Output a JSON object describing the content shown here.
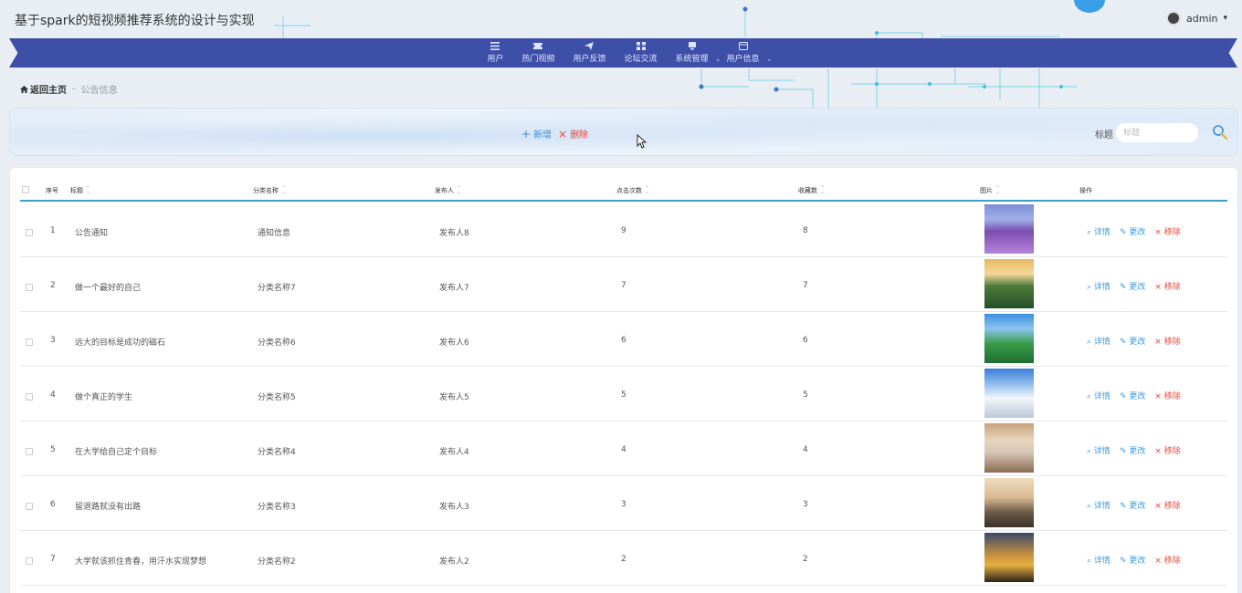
{
  "app": {
    "title": "基于spark的短视频推荐系统的设计与实现"
  },
  "user": {
    "name": "admin",
    "caret": "▾"
  },
  "nav": {
    "items": [
      {
        "label": "用户",
        "icon": "menu-icon",
        "dropdown": false
      },
      {
        "label": "热门视频",
        "icon": "ticket-icon",
        "dropdown": false
      },
      {
        "label": "用户反馈",
        "icon": "paper-plane-icon",
        "dropdown": false
      },
      {
        "label": "论坛交流",
        "icon": "grid-icon",
        "dropdown": false
      },
      {
        "label": "系统管理",
        "icon": "monitor-icon",
        "dropdown": true
      },
      {
        "label": "用户信息",
        "icon": "window-icon",
        "dropdown": true
      }
    ],
    "caret": "⌄"
  },
  "breadcrumb": {
    "home": "返回主页",
    "separator": "-",
    "current": "公告信息"
  },
  "toolbar": {
    "add_icon": "+",
    "add_label": "新增",
    "delete_icon": "×",
    "delete_label": "删除",
    "search_label": "标题",
    "search_placeholder": "标题",
    "search_value": ""
  },
  "table": {
    "headers": {
      "index": "序号",
      "title": "标题",
      "category": "分类名称",
      "publisher": "发布人",
      "clicks": "点击次数",
      "favorites": "收藏数",
      "image": "图片",
      "actions": "操作"
    },
    "sort_glyph_up": "⌃",
    "sort_glyph_down": "⌄",
    "actions": {
      "detail_icon": "⌕",
      "detail": "详情",
      "edit_icon": "✎",
      "edit": "更改",
      "remove_icon": "×",
      "remove": "移除"
    },
    "rows": [
      {
        "index": "1",
        "title": "公告通知",
        "category": "通知信息",
        "publisher": "发布人8",
        "clicks": "9",
        "favorites": "8",
        "image": "lavender-field"
      },
      {
        "index": "2",
        "title": "做一个最好的自己",
        "category": "分类名称7",
        "publisher": "发布人7",
        "clicks": "7",
        "favorites": "7",
        "image": "sunset-field"
      },
      {
        "index": "3",
        "title": "远大的目标是成功的磁石",
        "category": "分类名称6",
        "publisher": "发布人6",
        "clicks": "6",
        "favorites": "6",
        "image": "green-meadow"
      },
      {
        "index": "4",
        "title": "做个真正的学生",
        "category": "分类名称5",
        "publisher": "发布人5",
        "clicks": "5",
        "favorites": "5",
        "image": "snowy-mountain"
      },
      {
        "index": "5",
        "title": "在大学给自己定个目标",
        "category": "分类名称4",
        "publisher": "发布人4",
        "clicks": "4",
        "favorites": "4",
        "image": "misty-cliff"
      },
      {
        "index": "6",
        "title": "留退路就没有出路",
        "category": "分类名称3",
        "publisher": "发布人3",
        "clicks": "3",
        "favorites": "3",
        "image": "people-sunset"
      },
      {
        "index": "7",
        "title": "大学就该抓住青春，用汗水实现梦想",
        "category": "分类名称2",
        "publisher": "发布人2",
        "clicks": "2",
        "favorites": "2",
        "image": "golden-grass"
      }
    ]
  },
  "colors": {
    "nav_bg": "#3e4fa8",
    "accent_blue": "#3b9be0",
    "danger_red": "#e8483c",
    "header_line": "#3aa0c9"
  }
}
